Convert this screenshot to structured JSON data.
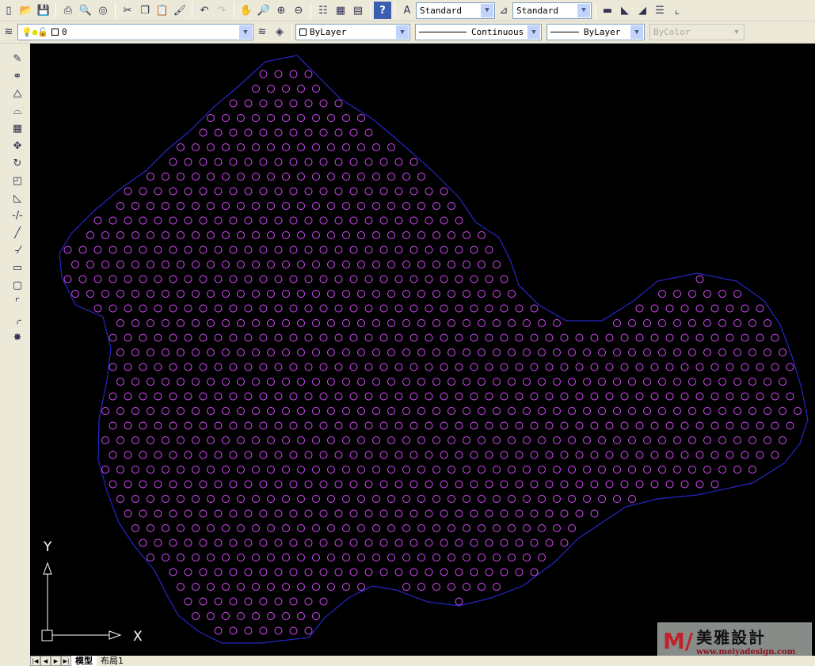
{
  "toolbar_standard": {
    "icons": [
      "new-icon",
      "open-icon",
      "save-icon",
      "print-icon",
      "print-preview-icon",
      "publish-icon",
      "cut-icon",
      "copy-icon",
      "paste-icon",
      "match-properties-icon",
      "undo-icon",
      "redo-icon",
      "pan-icon",
      "zoom-realtime-icon",
      "zoom-window-icon",
      "zoom-previous-icon",
      "properties-icon",
      "design-center-icon",
      "tool-palettes-icon",
      "help-icon"
    ]
  },
  "styles": {
    "text_style": "Standard",
    "dim_style": "Standard"
  },
  "layers": {
    "current": "0"
  },
  "properties": {
    "color": "ByLayer",
    "linetype": "Continuous",
    "lineweight": "ByLayer",
    "plotstyle": "ByColor"
  },
  "tabs": [
    {
      "label": "模型",
      "active": true
    },
    {
      "label": "布局1",
      "active": false
    }
  ],
  "ucs": {
    "x_label": "X",
    "y_label": "Y"
  },
  "watermark": {
    "brand": "美雅設計",
    "url": "www.meiyadesign.com"
  },
  "colors": {
    "circles": "#d94cff",
    "boundary": "#2626c8",
    "background": "#000000"
  }
}
